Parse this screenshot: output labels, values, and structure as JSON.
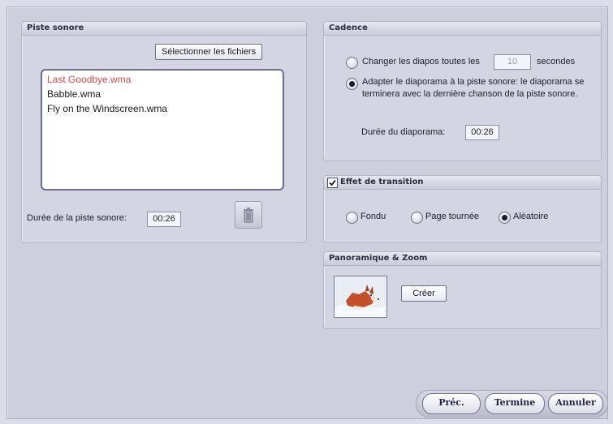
{
  "soundtrack": {
    "title": "Piste sonore",
    "select_files_label": "Sélectionner les fichiers",
    "files": [
      "Last Goodbye.wma",
      "Babble.wma",
      "Fly on the Windscreen.wma"
    ],
    "selected_index": 0,
    "duration_label": "Durée de la piste sonore:",
    "duration_value": "00:26",
    "delete_icon": "trash-icon"
  },
  "cadence": {
    "title": "Cadence",
    "option1_prefix": "Changer les diapos toutes les",
    "option1_value": "10",
    "option1_suffix": "secondes",
    "option2_line1": "Adapter le diaporama à la piste sonore: le diaporama se",
    "option2_line2": "terminera avec la dernière chanson de la piste sonore.",
    "selected_option": 2,
    "slideshow_duration_label": "Durée du diaporama:",
    "slideshow_duration_value": "00:26"
  },
  "transition": {
    "title": "Effet de transition",
    "enabled": true,
    "options": [
      "Fondu",
      "Page tournée",
      "Aléatoire"
    ],
    "selected": "Aléatoire"
  },
  "panzoom": {
    "title": "Panoramique & Zoom",
    "create_label": "Créer",
    "thumbnail": "fox-thumbnail"
  },
  "footer": {
    "prev_label": "Préc.",
    "finish_label": "Termine",
    "cancel_label": "Annuler"
  },
  "colors": {
    "selected_file": "#d94a4a",
    "panel_bg": "#d4d5e2",
    "window_bg": "#cdcfdd"
  }
}
